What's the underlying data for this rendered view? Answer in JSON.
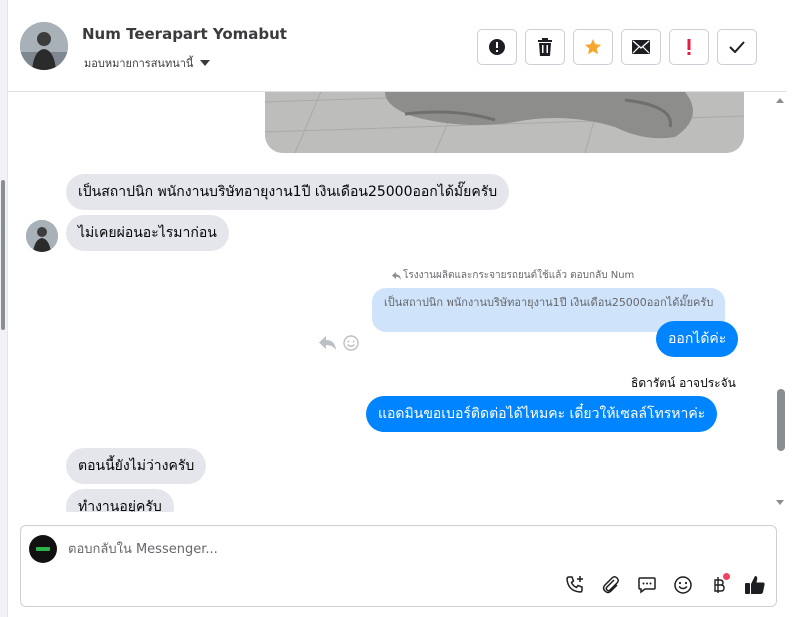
{
  "contact": {
    "name": "Num Teerapart Yomabut",
    "assign_label": "มอบหมายการสนทนานี้"
  },
  "actions": [
    {
      "name": "spam",
      "icon": "alert-circle-icon"
    },
    {
      "name": "delete",
      "icon": "trash-icon"
    },
    {
      "name": "star",
      "icon": "star-icon",
      "color": "#f7a52b"
    },
    {
      "name": "mark-unread",
      "icon": "envelope-icon"
    },
    {
      "name": "follow-up",
      "icon": "exclamation-icon",
      "color": "#e41e3f"
    },
    {
      "name": "done",
      "icon": "check-icon"
    }
  ],
  "messages": {
    "incoming_1": "เป็นสถาปนิก พนักงานบริษัทอายุงาน1ปี เงินเดือน25000ออกได้มั๊ยครับ",
    "incoming_2": "ไม่เคยผ่อนอะไรมาก่อน",
    "reply_hint": "โรงงานผลิตและกระจายรถยนต์ใช้แล้ว ตอบกลับ Num",
    "quoted_text": "เป็นสถาปนิก พนักงานบริษัทอายุงาน1ปี เงินเดือน25000ออกได้มั๊ยครับ",
    "outgoing_1": "ออกได้ค่ะ",
    "agent_name": "ธิดารัตน์ อาจประจัน",
    "outgoing_2": "แอดมินขอเบอร์ติดต่อได้ไหมคะ เดี๋ยวให้เซลล์โทรหาค่ะ",
    "incoming_3": "ตอนนี้ยังไม่ว่างครับ",
    "incoming_4": "ทำงานอยู่ครับ"
  },
  "composer": {
    "placeholder": "ตอบกลับใน Messenger...",
    "tools": [
      "call-add-icon",
      "paperclip-icon",
      "saved-reply-icon",
      "emoji-icon",
      "baht-icon",
      "thumbs-up-icon"
    ]
  },
  "colors": {
    "accent": "#0084ff",
    "incoming_bubble": "#e4e6eb",
    "quoted_bubble": "#cfe3fb"
  }
}
